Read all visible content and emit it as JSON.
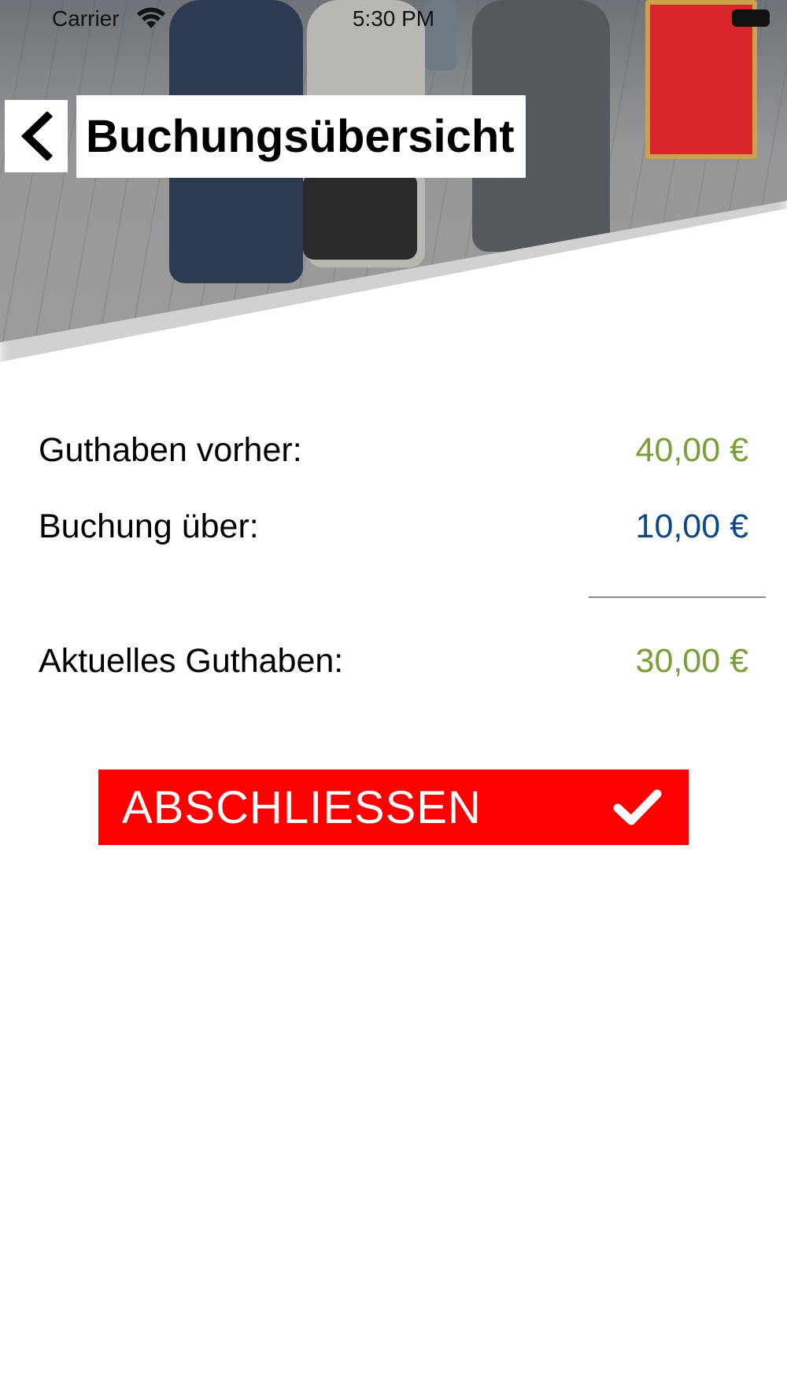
{
  "status_bar": {
    "carrier": "Carrier",
    "time": "5:30 PM"
  },
  "header": {
    "title": "Buchungsübersicht"
  },
  "summary": {
    "balance_before_label": "Guthaben vorher:",
    "balance_before_value": "40,00 €",
    "booking_label": "Buchung über:",
    "booking_value": "10,00 €",
    "current_balance_label": "Aktuelles Guthaben:",
    "current_balance_value": "30,00 €"
  },
  "action": {
    "confirm_label": "ABSCHLIESSEN",
    "confirm_icon": "check-icon"
  },
  "colors": {
    "positive": "#7a9e3a",
    "booking": "#0d4785",
    "button": "#ff0000"
  },
  "icons": {
    "back": "chevron-left-icon",
    "wifi": "wifi-icon",
    "battery": "battery-icon"
  }
}
